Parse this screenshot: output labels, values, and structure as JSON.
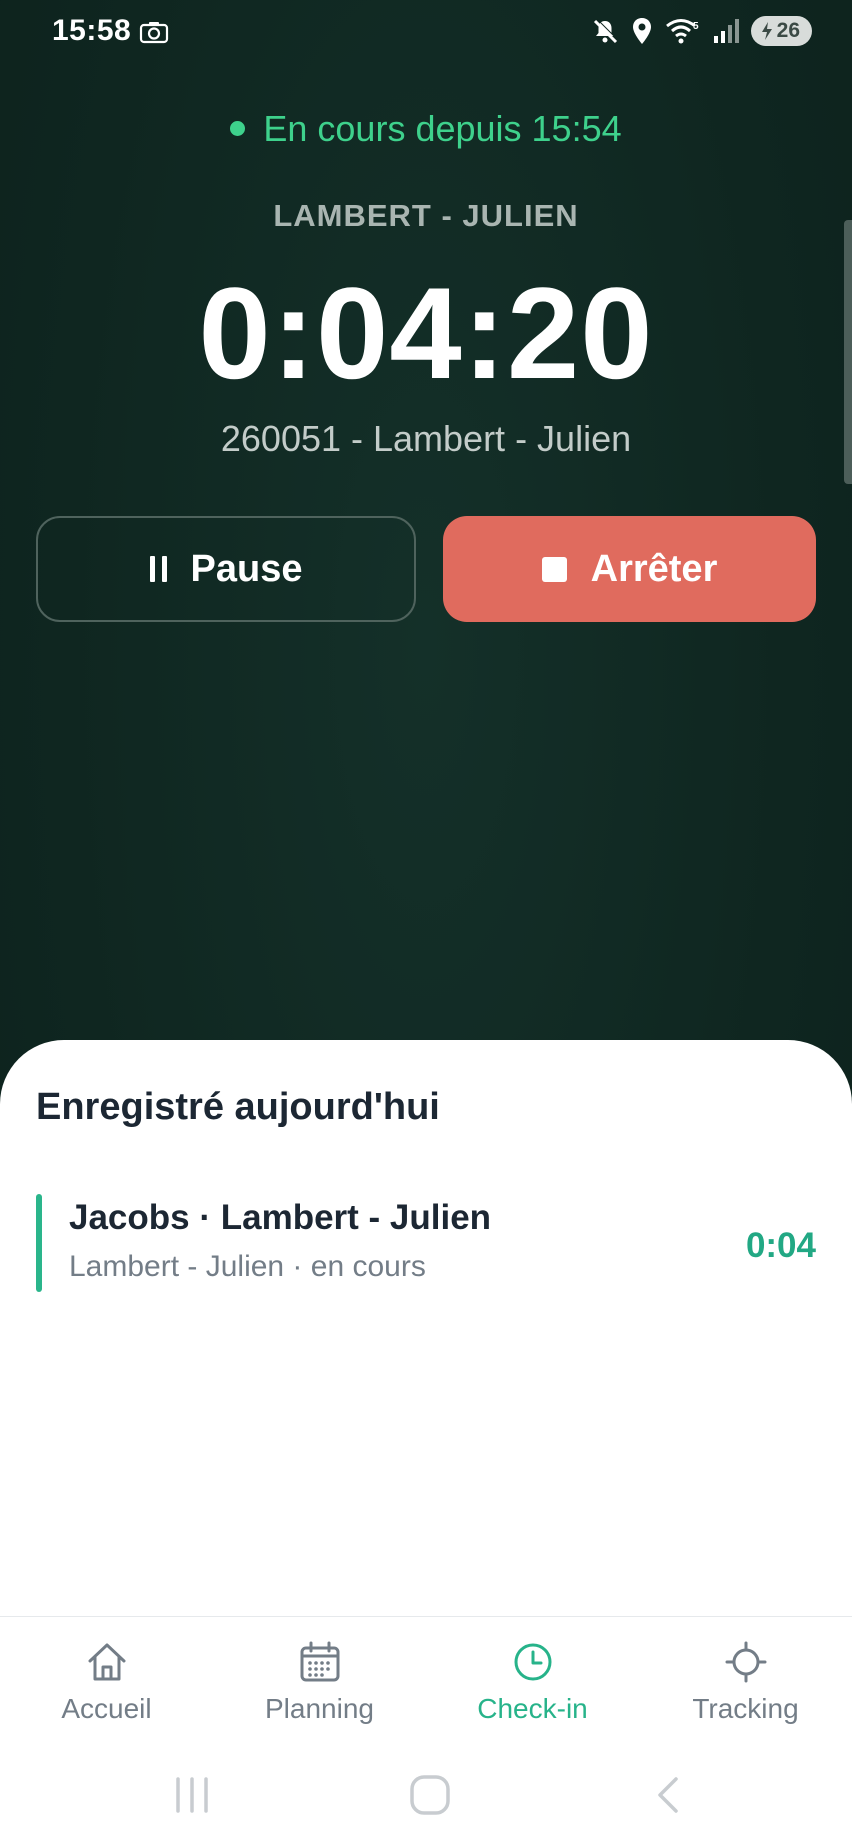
{
  "status_bar": {
    "time": "15:58",
    "battery": "26"
  },
  "session": {
    "status": "En cours depuis 15:54",
    "client": "LAMBERT - JULIEN",
    "timer": "0:04:20",
    "subtitle": "260051 - Lambert - Julien"
  },
  "actions": {
    "pause_label": "Pause",
    "stop_label": "Arrêter"
  },
  "today": {
    "title": "Enregistré aujourd'hui",
    "entries": [
      {
        "title": "Jacobs · Lambert - Julien",
        "subtitle": "Lambert - Julien · en cours",
        "duration": "0:04"
      }
    ]
  },
  "nav": {
    "items": [
      {
        "label": "Accueil",
        "icon": "home-icon"
      },
      {
        "label": "Planning",
        "icon": "calendar-icon"
      },
      {
        "label": "Check-in",
        "icon": "clock-icon",
        "active": true
      },
      {
        "label": "Tracking",
        "icon": "crosshair-icon"
      }
    ]
  },
  "colors": {
    "accent": "#27b38a",
    "stop": "#e06b5e",
    "running": "#3ed18c",
    "background": "#0f2620"
  }
}
